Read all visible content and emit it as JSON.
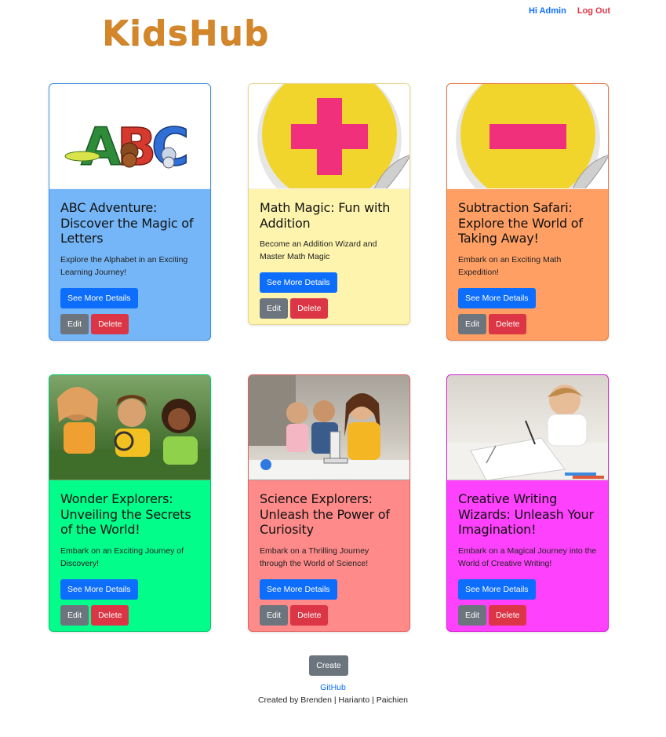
{
  "brand": {
    "logo_text": "KidsHub",
    "logo_color": "#d4872a"
  },
  "nav": {
    "greeting": "Hi Admin",
    "logout": "Log Out"
  },
  "cards": [
    {
      "title": "ABC Adventure: Discover the Magic of Letters",
      "description": "Explore the Alphabet in an Exciting Learning Journey!",
      "details": "See More Details",
      "edit": "Edit",
      "delete": "Delete",
      "bg": "#74b6f7",
      "border": "#3d8fe0",
      "image": "abc-letters-illustration"
    },
    {
      "title": "Math Magic: Fun with Addition",
      "description": "Become an Addition Wizard and Master Math Magic",
      "details": "See More Details",
      "edit": "Edit",
      "delete": "Delete",
      "bg": "#fef4ad",
      "border": "#e4d78a",
      "image": "plus-sign-sticker"
    },
    {
      "title": "Subtraction Safari: Explore the World of Taking Away!",
      "description": "Embark on an Exciting Math Expedition!",
      "details": "See More Details",
      "edit": "Edit",
      "delete": "Delete",
      "bg": "#ff9f63",
      "border": "#e9763d",
      "image": "minus-sign-sticker"
    },
    {
      "title": "Wonder Explorers: Unveiling the Secrets of the World!",
      "description": "Embark on an Exciting Journey of Discovery!",
      "details": "See More Details",
      "edit": "Edit",
      "delete": "Delete",
      "bg": "#02fd8b",
      "border": "#00c96d",
      "image": "children-with-magnifying-glass-photo"
    },
    {
      "title": "Science Explorers: Unleash the Power of Curiosity",
      "description": "Embark on a Thrilling Journey through the World of Science!",
      "details": "See More Details",
      "edit": "Edit",
      "delete": "Delete",
      "bg": "#ff8a8a",
      "border": "#e26363",
      "image": "children-microscope-photo"
    },
    {
      "title": "Creative Writing Wizards: Unleash Your Imagination!",
      "description": "Embark on a Magical Journey into the World of Creative Writing!",
      "details": "See More Details",
      "edit": "Edit",
      "delete": "Delete",
      "bg": "#fd41fd",
      "border": "#d822d8",
      "image": "child-drawing-photo"
    }
  ],
  "footer": {
    "create": "Create",
    "github": "GitHub",
    "credits": "Created by Brenden | Harianto | Paichien"
  }
}
